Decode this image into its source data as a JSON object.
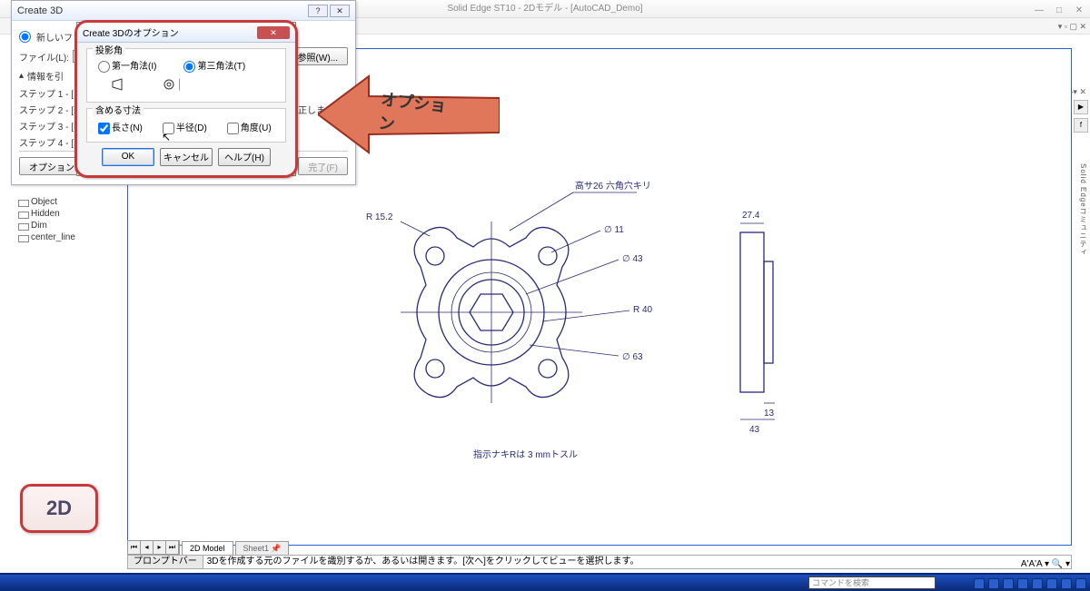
{
  "app": {
    "title": "Solid Edge ST10 - 2Dモデル - [AutoCAD_Demo]",
    "ribbon_collapse": "◂▸▾ ✕",
    "menu_right": "▾ ▫ ▢ ✕"
  },
  "wizard": {
    "title": "Create 3D",
    "new_file": "新しいファイル",
    "file_label": "ファイル(L):",
    "browse": "参照(W)...",
    "info": "情報を引",
    "steps": [
      "ステップ 1 - [オフ",
      "ステップ 2 - [新",
      "ステップ 3 - [参",
      "ステップ 4 - [次"
    ],
    "note_right": "正します。",
    "options_btn": "オプション(O)...",
    "finish_btn": "完了(F)"
  },
  "options": {
    "title": "Create 3Dのオプション",
    "group_projection": "投影角",
    "first_angle": "第一角法(I)",
    "third_angle": "第三角法(T)",
    "group_dims": "含める寸法",
    "chk_length": "長さ(N)",
    "chk_radius": "半径(D)",
    "chk_angle": "角度(U)",
    "ok": "OK",
    "cancel": "キャンセル",
    "help": "ヘルプ(H)"
  },
  "arrow_label": "オプション",
  "tree": [
    "Object",
    "Hidden",
    "Dim",
    "center_line"
  ],
  "drawing": {
    "note_top": "高サ26  六角穴キリ",
    "r152": "R 15.2",
    "d11": "∅ 11",
    "d43": "∅ 43",
    "r40": "R 40",
    "d63": "∅ 63",
    "w274": "27.4",
    "w13": "13",
    "w43": "43",
    "bottom_note": "指示ナキRは 3 mmトスル"
  },
  "tabs": {
    "model": "2D Model",
    "sheet": "Sheet1"
  },
  "prompt": {
    "label": "プロンプトバー",
    "text": "3Dを作成する元のファイルを識別するか、あるいは開きます。[次へ]をクリックしてビューを選択します。"
  },
  "txt_scale": "A'A'A ▾ 🔍 ▾",
  "task_search": "コマンドを検索",
  "badge": "2D"
}
